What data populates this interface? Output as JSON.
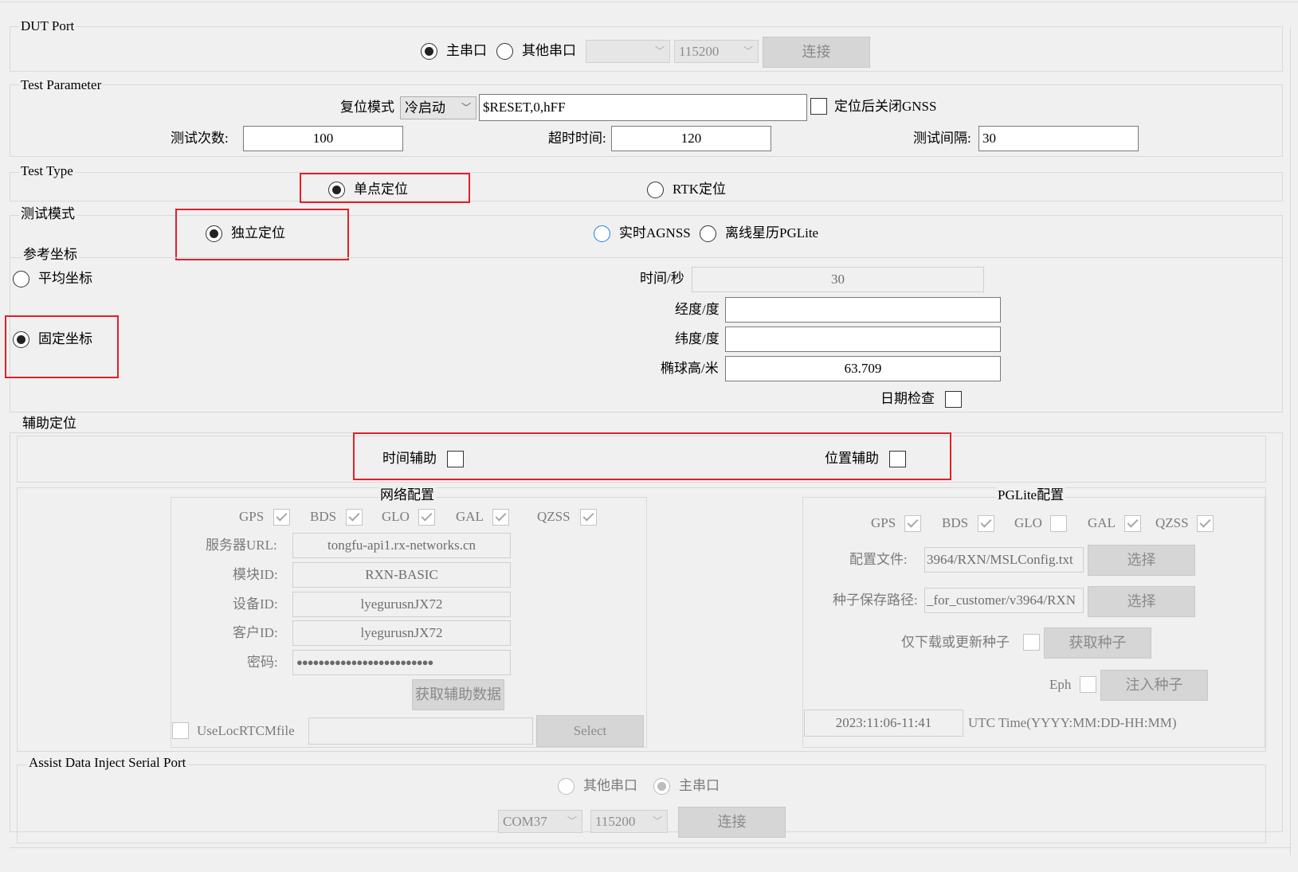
{
  "dut_port": {
    "title": "DUT Port",
    "main_serial": "主串口",
    "other_serial": "其他串口",
    "port_combo": "",
    "baud_combo": "115200",
    "connect": "连接"
  },
  "test_parameter": {
    "title": "Test Parameter",
    "reset_mode_label": "复位模式",
    "reset_mode_value": "冷启动",
    "reset_command": "$RESET,0,hFF",
    "close_gnss_label": "定位后关闭GNSS",
    "test_count_label": "测试次数:",
    "test_count_value": "100",
    "timeout_label": "超时时间:",
    "timeout_value": "120",
    "interval_label": "测试间隔:",
    "interval_value": "30"
  },
  "test_type": {
    "title": "Test Type",
    "single_point": "单点定位",
    "rtk": "RTK定位"
  },
  "test_mode": {
    "title": "测试模式",
    "standalone": "独立定位",
    "realtime_agnss": "实时AGNSS",
    "offline_pglite": "离线星历PGLite"
  },
  "reference": {
    "title": "参考坐标",
    "average": "平均坐标",
    "fixed": "固定坐标",
    "time_label": "时间/秒",
    "time_value": "30",
    "longitude_label": "经度/度",
    "longitude_value": "",
    "latitude_label": "纬度/度",
    "latitude_value": "",
    "height_label": "椭球高/米",
    "height_value": "63.709",
    "date_check_label": "日期检查"
  },
  "assist": {
    "title": "辅助定位",
    "time_assist": "时间辅助",
    "position_assist": "位置辅助"
  },
  "network": {
    "title": "网络配置",
    "constellations": [
      "GPS",
      "BDS",
      "GLO",
      "GAL",
      "QZSS"
    ],
    "server_url_label": "服务器URL:",
    "server_url_value": "tongfu-api1.rx-networks.cn",
    "module_id_label": "模块ID:",
    "module_id_value": "RXN-BASIC",
    "device_id_label": "设备ID:",
    "device_id_value": "lyegurusnJX72",
    "client_id_label": "客户ID:",
    "client_id_value": "lyegurusnJX72",
    "password_label": "密码:",
    "password_value": "●●●●●●●●●●●●●●●●●●●●●●●●●",
    "fetch_assist": "获取辅助数据",
    "use_loc_rtcm": "UseLocRTCMfile",
    "rtcm_path": "",
    "select": "Select"
  },
  "pglite": {
    "title": "PGLite配置",
    "constellations": [
      "GPS",
      "BDS",
      "GLO",
      "GAL",
      "QZSS"
    ],
    "config_file_label": "配置文件:",
    "config_file_value": "3964/RXN/MSLConfig.txt",
    "choose": "选择",
    "seed_path_label": "种子保存路径:",
    "seed_path_value": "_for_customer/v3964/RXN",
    "only_download_label": "仅下载或更新种子",
    "get_seed": "获取种子",
    "eph_label": "Eph",
    "inject_seed": "注入种子",
    "utc_value": "2023:11:06-11:41",
    "utc_label": "UTC Time(YYYY:MM:DD-HH:MM)"
  },
  "inject_port": {
    "title": "Assist Data Inject Serial Port",
    "other_serial": "其他串口",
    "main_serial": "主串口",
    "port_combo": "COM37",
    "baud_combo": "115200",
    "connect": "连接"
  }
}
